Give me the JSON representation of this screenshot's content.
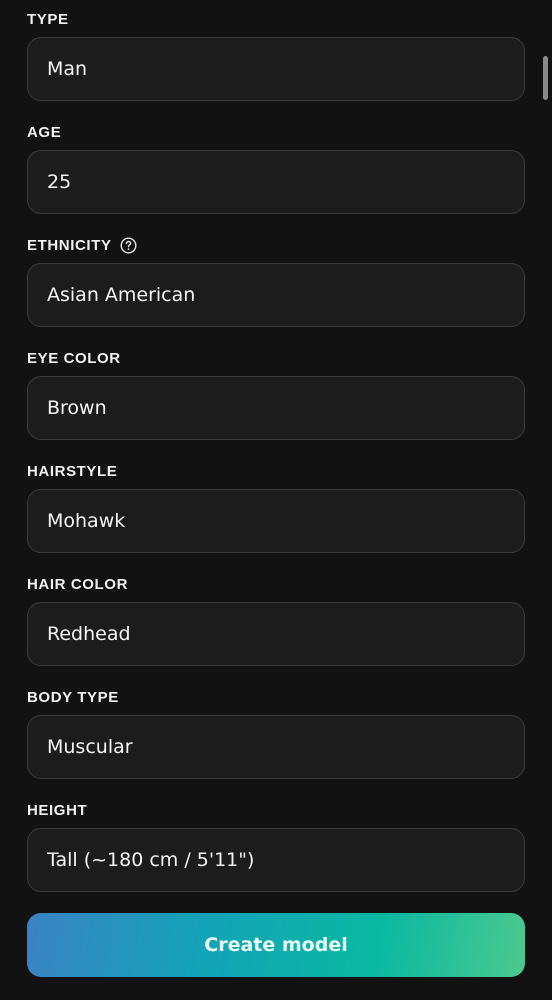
{
  "fields": [
    {
      "label": "TYPE",
      "value": "Man"
    },
    {
      "label": "AGE",
      "value": "25"
    },
    {
      "label": "ETHNICITY",
      "value": "Asian American",
      "help_icon": "question-circle-icon"
    },
    {
      "label": "EYE COLOR",
      "value": "Brown"
    },
    {
      "label": "HAIRSTYLE",
      "value": "Mohawk"
    },
    {
      "label": "HAIR COLOR",
      "value": "Redhead"
    },
    {
      "label": "BODY TYPE",
      "value": "Muscular"
    },
    {
      "label": "HEIGHT",
      "value": "Tall (~180 cm / 5'11\")"
    }
  ],
  "create_button": {
    "label": "Create model"
  },
  "colors": {
    "background": "#121212",
    "field_background": "#1c1c1c",
    "field_border": "#3a3a3a",
    "button_gradient_start": "#3b82c4",
    "button_gradient_end": "#4cc98f"
  }
}
